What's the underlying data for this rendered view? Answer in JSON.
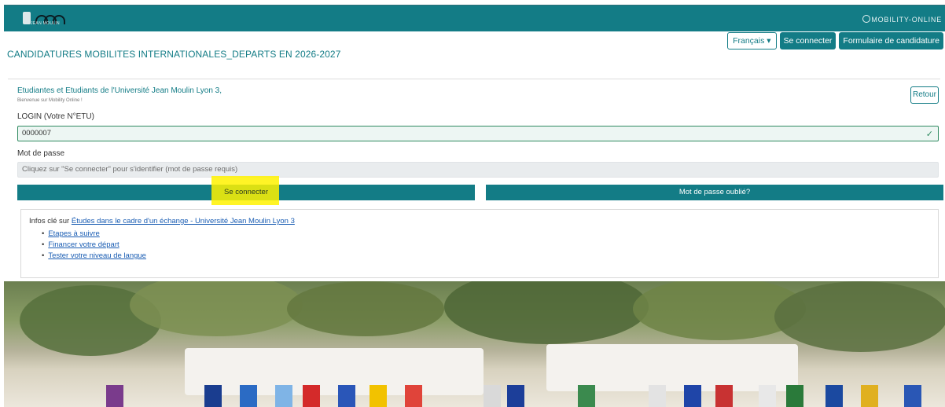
{
  "topbar": {
    "university_sub": "JEAN MOULIN",
    "brand": "MOBILITY-ONLINE"
  },
  "header": {
    "title": "CANDIDATURES MOBILITES INTERNATIONALES_DEPARTS EN 2026-2027",
    "language_button": "Français ▾",
    "login_button": "Se connecter",
    "application_form_button": "Formulaire de candidature"
  },
  "form": {
    "greeting": "Etudiantes et Etudiants de l'Université Jean Moulin Lyon 3,",
    "welcome": "Bienvenue sur Mobility Online !",
    "back_button": "Retour",
    "login_label": "LOGIN (Votre N°ETU)",
    "login_value": "0000007",
    "password_label": "Mot de passe",
    "password_placeholder": "Cliquez sur \"Se connecter\" pour s'identifier (mot de passe requis)",
    "connect_button": "Se connecter",
    "forgot_button": "Mot de passe oublié?"
  },
  "info": {
    "intro": "Infos clé sur",
    "main_link": "Études dans le cadre d'un échange - Université Jean Moulin Lyon 3",
    "links": [
      "Etapes à suivre",
      "Financer votre départ",
      "Tester votre niveau de langue"
    ]
  },
  "colors": {
    "accent": "#137c86",
    "highlight": "#fff200",
    "link": "#1a5db3"
  }
}
